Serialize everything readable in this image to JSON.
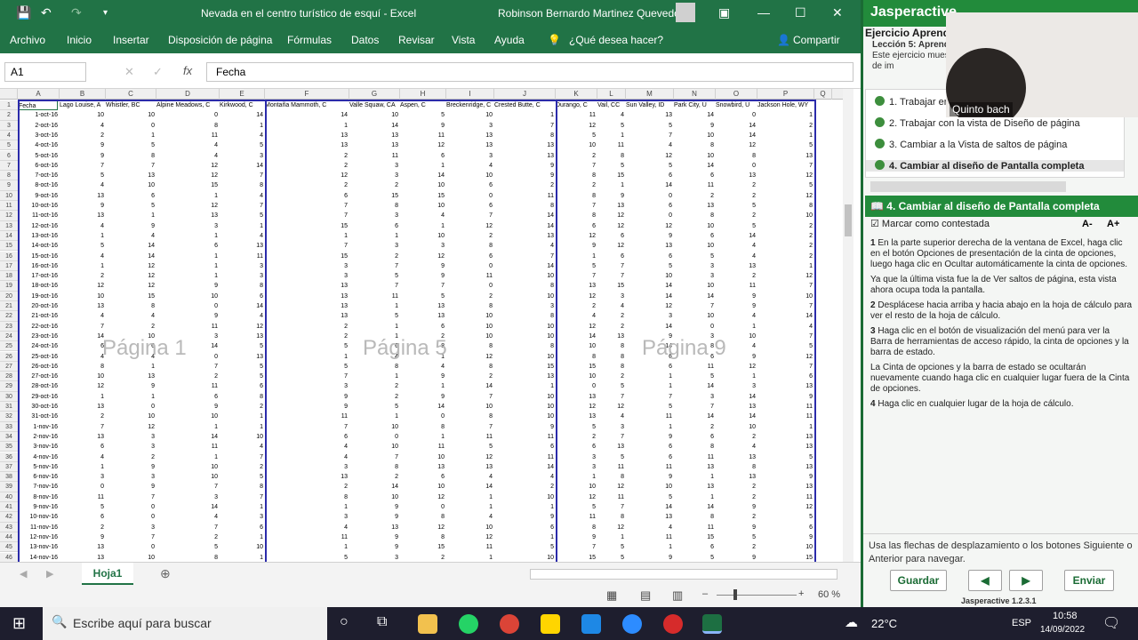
{
  "excel": {
    "title": "Nevada en el centro turístico de esquí  -  Excel",
    "user": "Robinson Bernardo Martinez Quevedo",
    "ribbon_tabs": [
      "Archivo",
      "Inicio",
      "Insertar",
      "Disposición de página",
      "Fórmulas",
      "Datos",
      "Revisar",
      "Vista",
      "Ayuda"
    ],
    "tell_me": "¿Qué desea hacer?",
    "share": "Compartir",
    "name_box": "A1",
    "formula_value": "Fecha",
    "columns": [
      "A",
      "B",
      "C",
      "D",
      "E",
      "F",
      "G",
      "H",
      "I",
      "J",
      "K",
      "L",
      "M",
      "N",
      "O",
      "P",
      "Q"
    ],
    "header_row": [
      "Fecha",
      "Lago Louise, A",
      "Whistler, BC",
      "Alpine Meadows, C",
      "Kirkwood, C",
      "Montaña Mammoth, C",
      "Valle Squaw, CA",
      "Aspen, C",
      "Breckenridge, C",
      "Crested Butte, C",
      "Durango, C",
      "Vail, CC",
      "Sun Valley, ID",
      "Park City, U",
      "Snowbird, U",
      "Jackson Hole, WY"
    ],
    "rows": [
      [
        "1-oct-16",
        10,
        10,
        0,
        14,
        14,
        10,
        5,
        10,
        1,
        11,
        4,
        13,
        14,
        0,
        1
      ],
      [
        "2-oct-16",
        4,
        0,
        8,
        1,
        1,
        14,
        9,
        3,
        7,
        12,
        5,
        5,
        9,
        14,
        2
      ],
      [
        "3-oct-16",
        2,
        1,
        11,
        4,
        13,
        13,
        11,
        13,
        8,
        5,
        1,
        7,
        10,
        14,
        1
      ],
      [
        "4-oct-16",
        9,
        5,
        4,
        5,
        13,
        13,
        12,
        13,
        13,
        10,
        11,
        4,
        8,
        12,
        5
      ],
      [
        "5-oct-16",
        9,
        8,
        4,
        3,
        2,
        11,
        6,
        3,
        13,
        2,
        8,
        12,
        10,
        8,
        13
      ],
      [
        "6-oct-16",
        7,
        7,
        12,
        14,
        2,
        3,
        1,
        4,
        9,
        7,
        5,
        5,
        14,
        0,
        7
      ],
      [
        "7-oct-16",
        5,
        13,
        12,
        7,
        12,
        3,
        14,
        10,
        9,
        8,
        15,
        6,
        6,
        13,
        12
      ],
      [
        "8-oct-16",
        4,
        10,
        15,
        8,
        2,
        2,
        10,
        6,
        2,
        2,
        1,
        14,
        11,
        2,
        5
      ],
      [
        "9-oct-16",
        13,
        6,
        1,
        4,
        6,
        15,
        15,
        0,
        11,
        8,
        9,
        0,
        2,
        2,
        12
      ],
      [
        "10-oct-16",
        9,
        5,
        12,
        7,
        7,
        8,
        10,
        6,
        8,
        7,
        13,
        6,
        13,
        5,
        8
      ],
      [
        "11-oct-16",
        13,
        1,
        13,
        5,
        7,
        3,
        4,
        7,
        14,
        8,
        12,
        0,
        8,
        2,
        10
      ],
      [
        "12-oct-16",
        4,
        9,
        3,
        1,
        15,
        6,
        1,
        12,
        14,
        6,
        12,
        12,
        10,
        5,
        2
      ],
      [
        "13-oct-16",
        1,
        4,
        1,
        4,
        1,
        1,
        10,
        2,
        13,
        12,
        6,
        9,
        6,
        14,
        2
      ],
      [
        "14-oct-16",
        5,
        14,
        6,
        13,
        7,
        3,
        3,
        8,
        4,
        9,
        12,
        13,
        10,
        4,
        2
      ],
      [
        "15-oct-16",
        4,
        14,
        1,
        11,
        15,
        2,
        12,
        6,
        7,
        1,
        6,
        6,
        5,
        4,
        2
      ],
      [
        "16-oct-16",
        1,
        12,
        1,
        3,
        3,
        7,
        9,
        0,
        14,
        5,
        7,
        5,
        3,
        13,
        1
      ],
      [
        "17-oct-16",
        2,
        12,
        1,
        3,
        3,
        5,
        9,
        11,
        10,
        7,
        7,
        10,
        3,
        2,
        12
      ],
      [
        "18-oct-16",
        12,
        12,
        9,
        8,
        13,
        7,
        7,
        0,
        8,
        13,
        15,
        14,
        10,
        11,
        7
      ],
      [
        "19-oct-16",
        10,
        15,
        10,
        6,
        13,
        11,
        5,
        2,
        10,
        12,
        3,
        14,
        14,
        9,
        10
      ],
      [
        "20-oct-16",
        13,
        8,
        0,
        14,
        13,
        1,
        13,
        8,
        3,
        2,
        4,
        12,
        7,
        9,
        7
      ],
      [
        "21-oct-16",
        4,
        4,
        9,
        4,
        13,
        5,
        13,
        10,
        8,
        4,
        2,
        3,
        10,
        4,
        14
      ],
      [
        "22-oct-16",
        7,
        2,
        11,
        12,
        2,
        1,
        6,
        10,
        10,
        12,
        2,
        14,
        0,
        1,
        4
      ],
      [
        "23-oct-16",
        14,
        10,
        3,
        13,
        2,
        1,
        2,
        10,
        10,
        14,
        13,
        9,
        3,
        10,
        7
      ],
      [
        "24-oct-16",
        6,
        6,
        14,
        5,
        5,
        6,
        8,
        8,
        8,
        10,
        8,
        14,
        8,
        4,
        5
      ],
      [
        "25-oct-16",
        4,
        4,
        0,
        13,
        1,
        4,
        1,
        12,
        10,
        8,
        8,
        6,
        6,
        9,
        12
      ],
      [
        "26-oct-16",
        8,
        1,
        7,
        5,
        5,
        8,
        4,
        8,
        15,
        15,
        8,
        6,
        11,
        12,
        7
      ],
      [
        "27-oct-16",
        10,
        13,
        2,
        5,
        7,
        1,
        9,
        2,
        13,
        10,
        2,
        1,
        5,
        1,
        6
      ],
      [
        "28-oct-16",
        12,
        9,
        11,
        6,
        3,
        2,
        1,
        14,
        1,
        0,
        5,
        1,
        14,
        3,
        13
      ],
      [
        "29-oct-16",
        1,
        1,
        6,
        8,
        9,
        2,
        9,
        7,
        10,
        13,
        7,
        7,
        3,
        14,
        9
      ],
      [
        "30-oct-16",
        13,
        0,
        9,
        2,
        9,
        5,
        14,
        10,
        10,
        12,
        12,
        5,
        7,
        13,
        11
      ],
      [
        "31-oct-16",
        2,
        10,
        10,
        1,
        11,
        1,
        0,
        8,
        10,
        13,
        4,
        11,
        14,
        14,
        11
      ],
      [
        "1-nov-16",
        7,
        12,
        1,
        1,
        7,
        10,
        8,
        7,
        9,
        5,
        3,
        1,
        2,
        10,
        1
      ],
      [
        "2-nov-16",
        13,
        3,
        14,
        10,
        6,
        0,
        1,
        11,
        11,
        2,
        7,
        9,
        6,
        2,
        13
      ],
      [
        "3-nov-16",
        6,
        3,
        11,
        4,
        4,
        10,
        11,
        5,
        6,
        6,
        13,
        6,
        8,
        4,
        13
      ],
      [
        "4-nov-16",
        4,
        2,
        1,
        7,
        4,
        7,
        10,
        12,
        11,
        3,
        5,
        6,
        11,
        13,
        5
      ],
      [
        "5-nov-16",
        1,
        9,
        10,
        2,
        3,
        8,
        13,
        13,
        14,
        3,
        11,
        11,
        13,
        8,
        13
      ],
      [
        "6-nov-16",
        3,
        3,
        10,
        5,
        13,
        2,
        6,
        4,
        4,
        1,
        8,
        9,
        1,
        13,
        9
      ],
      [
        "7-nov-16",
        0,
        9,
        7,
        8,
        2,
        14,
        10,
        14,
        2,
        10,
        12,
        10,
        13,
        2,
        13
      ],
      [
        "8-nov-16",
        11,
        7,
        3,
        7,
        8,
        10,
        12,
        1,
        10,
        12,
        11,
        5,
        1,
        2,
        11
      ],
      [
        "9-nov-16",
        5,
        0,
        14,
        1,
        1,
        9,
        0,
        1,
        1,
        5,
        7,
        14,
        14,
        9,
        12
      ],
      [
        "10-nov-16",
        6,
        0,
        4,
        3,
        3,
        9,
        8,
        4,
        9,
        11,
        8,
        13,
        8,
        2,
        5
      ],
      [
        "11-nov-16",
        2,
        3,
        7,
        6,
        4,
        13,
        12,
        10,
        6,
        8,
        12,
        4,
        11,
        9,
        6
      ],
      [
        "12-nov-16",
        9,
        7,
        2,
        1,
        11,
        9,
        8,
        12,
        1,
        9,
        1,
        11,
        15,
        5,
        9
      ],
      [
        "13-nov-16",
        13,
        0,
        5,
        10,
        1,
        9,
        15,
        11,
        5,
        7,
        5,
        1,
        6,
        2,
        10
      ],
      [
        "14-nov-16",
        13,
        10,
        8,
        1,
        5,
        3,
        2,
        1,
        10,
        15,
        5,
        9,
        5,
        9,
        15
      ]
    ],
    "watermarks": [
      "Página 1",
      "Página 5",
      "Página 9"
    ],
    "sheet_tab": "Hoja1",
    "zoom": "60 %"
  },
  "jasper": {
    "brand": "Jasperactive",
    "lesson_title": "Ejercicio Aprendizaje",
    "lesson_sub": "Lección 5: Aprender",
    "intro": "Este ejercicio muestra diferentes vistas de herramienta de im",
    "steps": [
      "1. Trabajar en",
      "2. Trabajar con la vista de Diseño de página",
      "3. Cambiar a la Vista de saltos de página",
      "4. Cambiar al diseño de Pantalla completa"
    ],
    "section_title": "4. Cambiar al diseño de Pantalla completa",
    "mark_answered": "Marcar como contestada",
    "font_minus": "A-",
    "font_plus": "A+",
    "instructions": [
      "En la parte superior derecha de la ventana de Excel, haga clic en el botón Opciones de presentación de la cinta de opciones, luego haga clic en Ocultar automáticamente la cinta de opciones.",
      "Ya que la última vista fue la de Ver saltos de página, esta vista ahora ocupa toda la pantalla.",
      "Desplácese hacia arriba y hacia abajo en la hoja de cálculo para ver el resto de la hoja de cálculo.",
      "Haga clic en el botón de visualización del menú para ver la Barra de herramientas de acceso rápido, la cinta de opciones y la barra de estado.",
      "La Cinta de opciones y la barra de estado se ocultarán nuevamente cuando haga clic en cualquier lugar fuera de la Cinta de opciones.",
      "Haga clic en cualquier lugar de la hoja de cálculo."
    ],
    "instruction_numbers": [
      "1",
      "",
      "2",
      "3",
      "",
      "4"
    ],
    "nav_hint": "Usa las flechas de desplazamiento o los botones Siguiente o Anterior para navegar.",
    "btn_save": "Guardar",
    "btn_prev": "◀",
    "btn_next": "▶",
    "btn_submit": "Enviar",
    "version": "Jasperactive 1.2.3.1",
    "video_caption": "Quinto bach"
  },
  "taskbar": {
    "search_placeholder": "Escribe aquí para buscar",
    "weather": "22°C",
    "lang": "ESP",
    "time": "10:58",
    "date": "14/09/2022"
  },
  "colors": {
    "excel_green": "#217346",
    "jasper_green": "#228b3b",
    "page_break_blue": "#2b2baa"
  }
}
